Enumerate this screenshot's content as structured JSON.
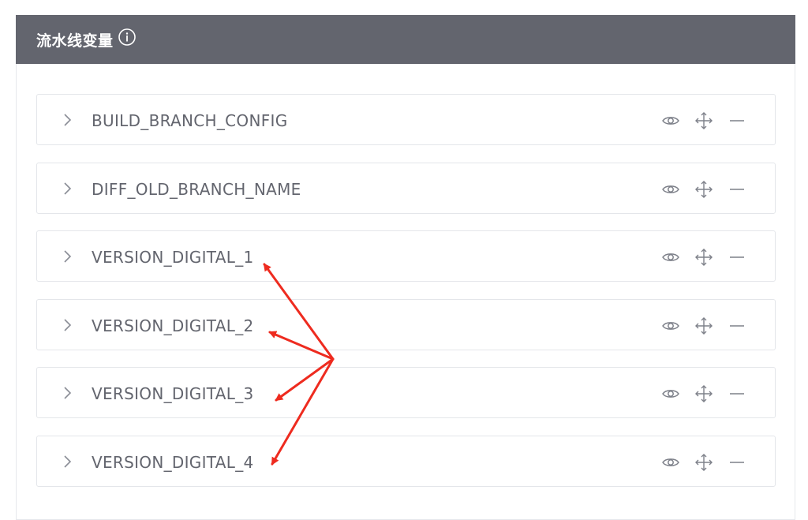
{
  "header": {
    "title": "流水线变量",
    "info_icon": "info-circle-icon"
  },
  "variables": [
    {
      "name": "BUILD_BRANCH_CONFIG"
    },
    {
      "name": "DIFF_OLD_BRANCH_NAME"
    },
    {
      "name": "VERSION_DIGITAL_1"
    },
    {
      "name": "VERSION_DIGITAL_2"
    },
    {
      "name": "VERSION_DIGITAL_3"
    },
    {
      "name": "VERSION_DIGITAL_4"
    }
  ],
  "row_actions": [
    "eye-icon",
    "move-icon",
    "minus-icon"
  ],
  "colors": {
    "header_bg": "#63656e",
    "text": "#63656e",
    "border": "#e4e6ea",
    "annotation_arrow": "#ee2b1f"
  }
}
